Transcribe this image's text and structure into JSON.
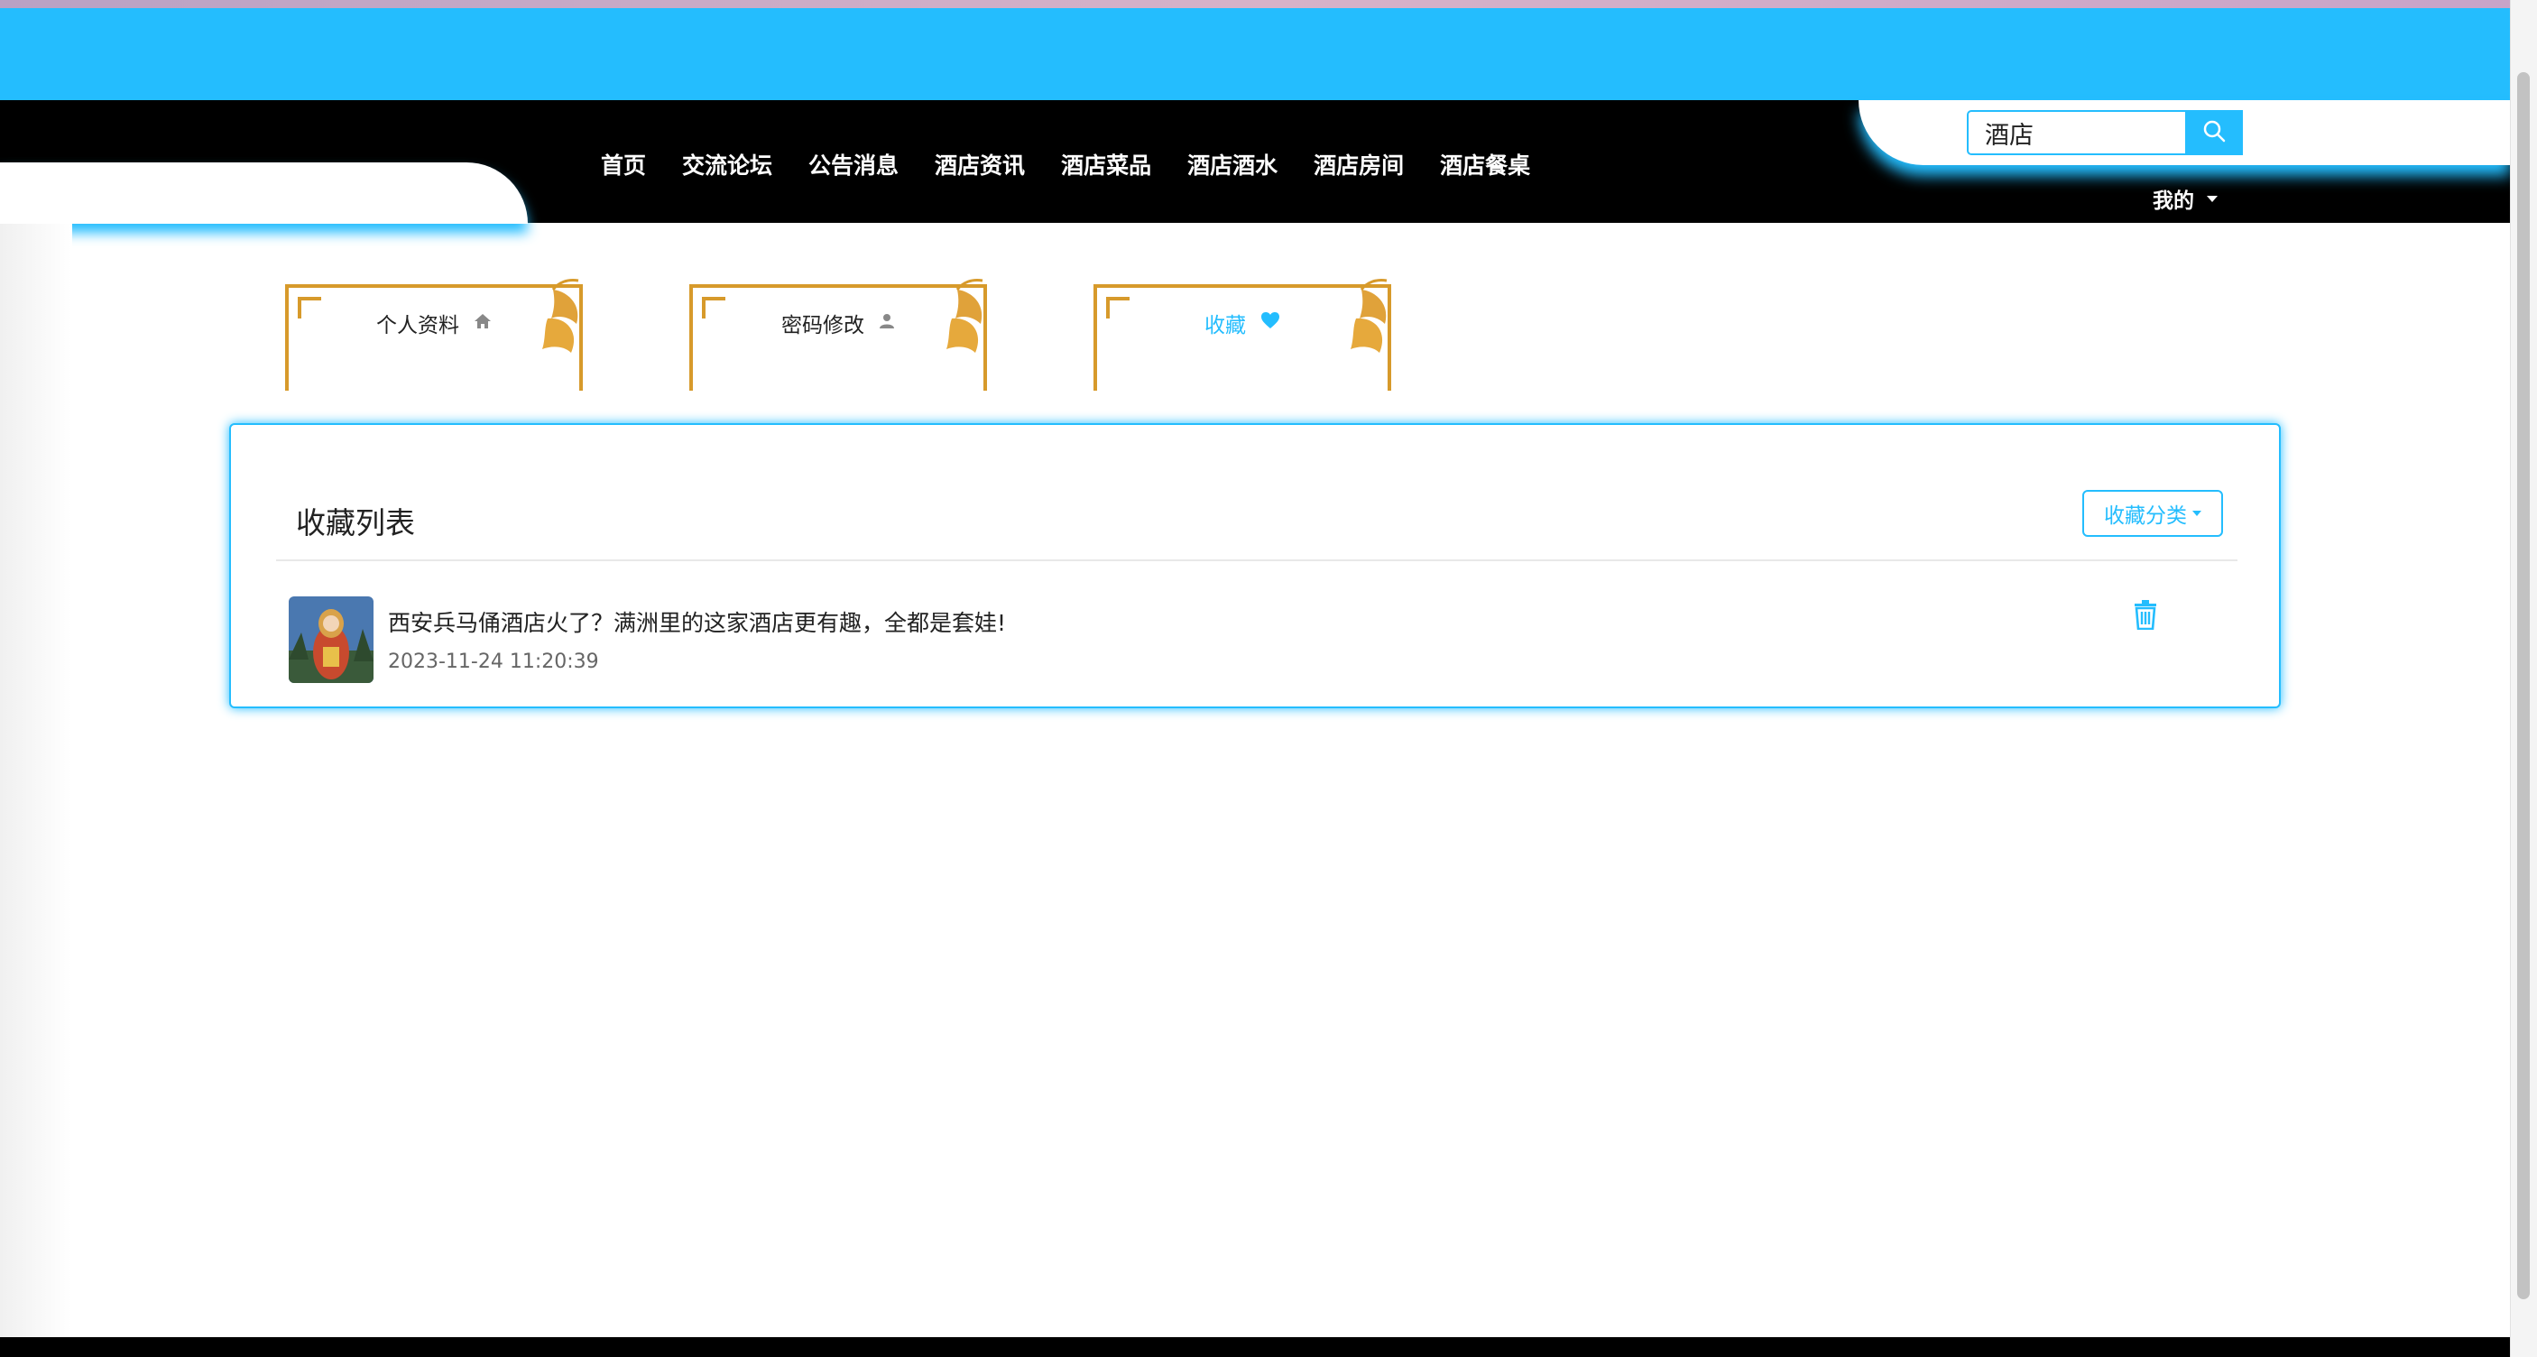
{
  "nav": {
    "items": [
      "首页",
      "交流论坛",
      "公告消息",
      "酒店资讯",
      "酒店菜品",
      "酒店酒水",
      "酒店房间",
      "酒店餐桌"
    ],
    "search_value": "酒店",
    "my_label": "我的"
  },
  "tabs": [
    {
      "label": "个人资料",
      "icon": "home-icon",
      "active": false
    },
    {
      "label": "密码修改",
      "icon": "user-icon",
      "active": false
    },
    {
      "label": "收藏",
      "icon": "heart-icon",
      "active": true
    }
  ],
  "panel": {
    "title": "收藏列表",
    "category_button": "收藏分类",
    "items": [
      {
        "title": "西安兵马俑酒店火了？满洲里的这家酒店更有趣，全都是套娃!",
        "time": "2023-11-24 11:20:39"
      }
    ]
  },
  "colors": {
    "accent": "#24bdfe",
    "gold": "#d79a2b",
    "nav_bg": "#000000"
  }
}
